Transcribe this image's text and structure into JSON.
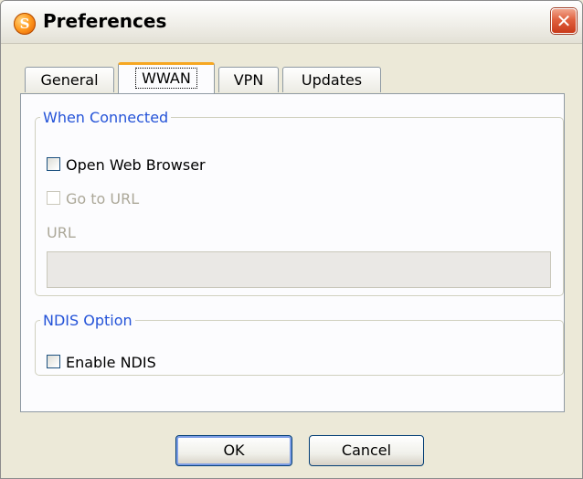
{
  "window": {
    "title": "Preferences",
    "close_glyph": "✕",
    "icon": "app-logo-icon"
  },
  "tabs": [
    {
      "label": "General",
      "active": false
    },
    {
      "label": "WWAN",
      "active": true
    },
    {
      "label": "VPN",
      "active": false
    },
    {
      "label": "Updates",
      "active": false
    }
  ],
  "when_connected": {
    "legend": "When Connected",
    "open_web_browser": {
      "label": "Open Web Browser",
      "checked": false,
      "enabled": true
    },
    "go_to_url": {
      "label": "Go to URL",
      "checked": false,
      "enabled": false
    },
    "url_label": "URL",
    "url_value": ""
  },
  "ndis": {
    "legend": "NDIS Option",
    "enable_ndis": {
      "label": "Enable NDIS",
      "checked": false,
      "enabled": true
    }
  },
  "buttons": {
    "ok": "OK",
    "cancel": "Cancel"
  },
  "colors": {
    "group_legend": "#2453d8",
    "active_tab_accent": "#f6a722",
    "close_button": "#e0603e"
  }
}
